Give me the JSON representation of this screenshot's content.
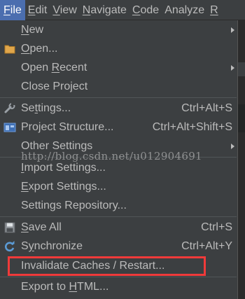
{
  "menubar": {
    "items": [
      {
        "mnemonic": "F",
        "rest": "ile"
      },
      {
        "mnemonic": "E",
        "rest": "dit"
      },
      {
        "mnemonic": "V",
        "rest": "iew"
      },
      {
        "mnemonic": "N",
        "rest": "avigate"
      },
      {
        "mnemonic": "C",
        "rest": "ode"
      },
      {
        "mnemonic": "",
        "rest": "Analyze"
      },
      {
        "mnemonic": "R",
        "rest": ""
      }
    ]
  },
  "file_menu": {
    "items": [
      {
        "pre": "",
        "mn": "N",
        "post": "ew",
        "shortcut": "",
        "submenu": true,
        "icon": null
      },
      {
        "pre": "",
        "mn": "O",
        "post": "pen...",
        "shortcut": "",
        "submenu": false,
        "icon": "folder-icon"
      },
      {
        "pre": "Open ",
        "mn": "R",
        "post": "ecent",
        "shortcut": "",
        "submenu": true,
        "icon": null
      },
      {
        "pre": "Close Project",
        "mn": "",
        "post": "",
        "shortcut": "",
        "submenu": false,
        "icon": null
      },
      {
        "pre": "Se",
        "mn": "t",
        "post": "tings...",
        "shortcut": "Ctrl+Alt+S",
        "submenu": false,
        "icon": "wrench-icon"
      },
      {
        "pre": "Project Structure...",
        "mn": "",
        "post": "",
        "shortcut": "Ctrl+Alt+Shift+S",
        "submenu": false,
        "icon": "project-structure-icon"
      },
      {
        "pre": "Other Settings",
        "mn": "",
        "post": "",
        "shortcut": "",
        "submenu": true,
        "icon": null
      },
      {
        "pre": "",
        "mn": "I",
        "post": "mport Settings...",
        "shortcut": "",
        "submenu": false,
        "icon": null
      },
      {
        "pre": "",
        "mn": "E",
        "post": "xport Settings...",
        "shortcut": "",
        "submenu": false,
        "icon": null
      },
      {
        "pre": "Settings Repository...",
        "mn": "",
        "post": "",
        "shortcut": "",
        "submenu": false,
        "icon": null
      },
      {
        "pre": "",
        "mn": "S",
        "post": "ave All",
        "shortcut": "Ctrl+S",
        "submenu": false,
        "icon": "save-icon"
      },
      {
        "pre": "S",
        "mn": "y",
        "post": "nchronize",
        "shortcut": "Ctrl+Alt+Y",
        "submenu": false,
        "icon": "sync-icon"
      },
      {
        "pre": "Invalidate Caches / Restart...",
        "mn": "",
        "post": "",
        "shortcut": "",
        "submenu": false,
        "icon": null
      },
      {
        "pre": "Export to ",
        "mn": "H",
        "post": "TML...",
        "shortcut": "",
        "submenu": false,
        "icon": null
      }
    ]
  },
  "watermark": "http://blog.csdn.net/u012904691",
  "colors": {
    "menubar_bg": "#3c3f41",
    "menu_bg": "#3c3f41",
    "text": "#bbbbbb",
    "active_menu": "#4b6eaf",
    "highlight_border": "#f03a3a",
    "separator": "#515658"
  }
}
